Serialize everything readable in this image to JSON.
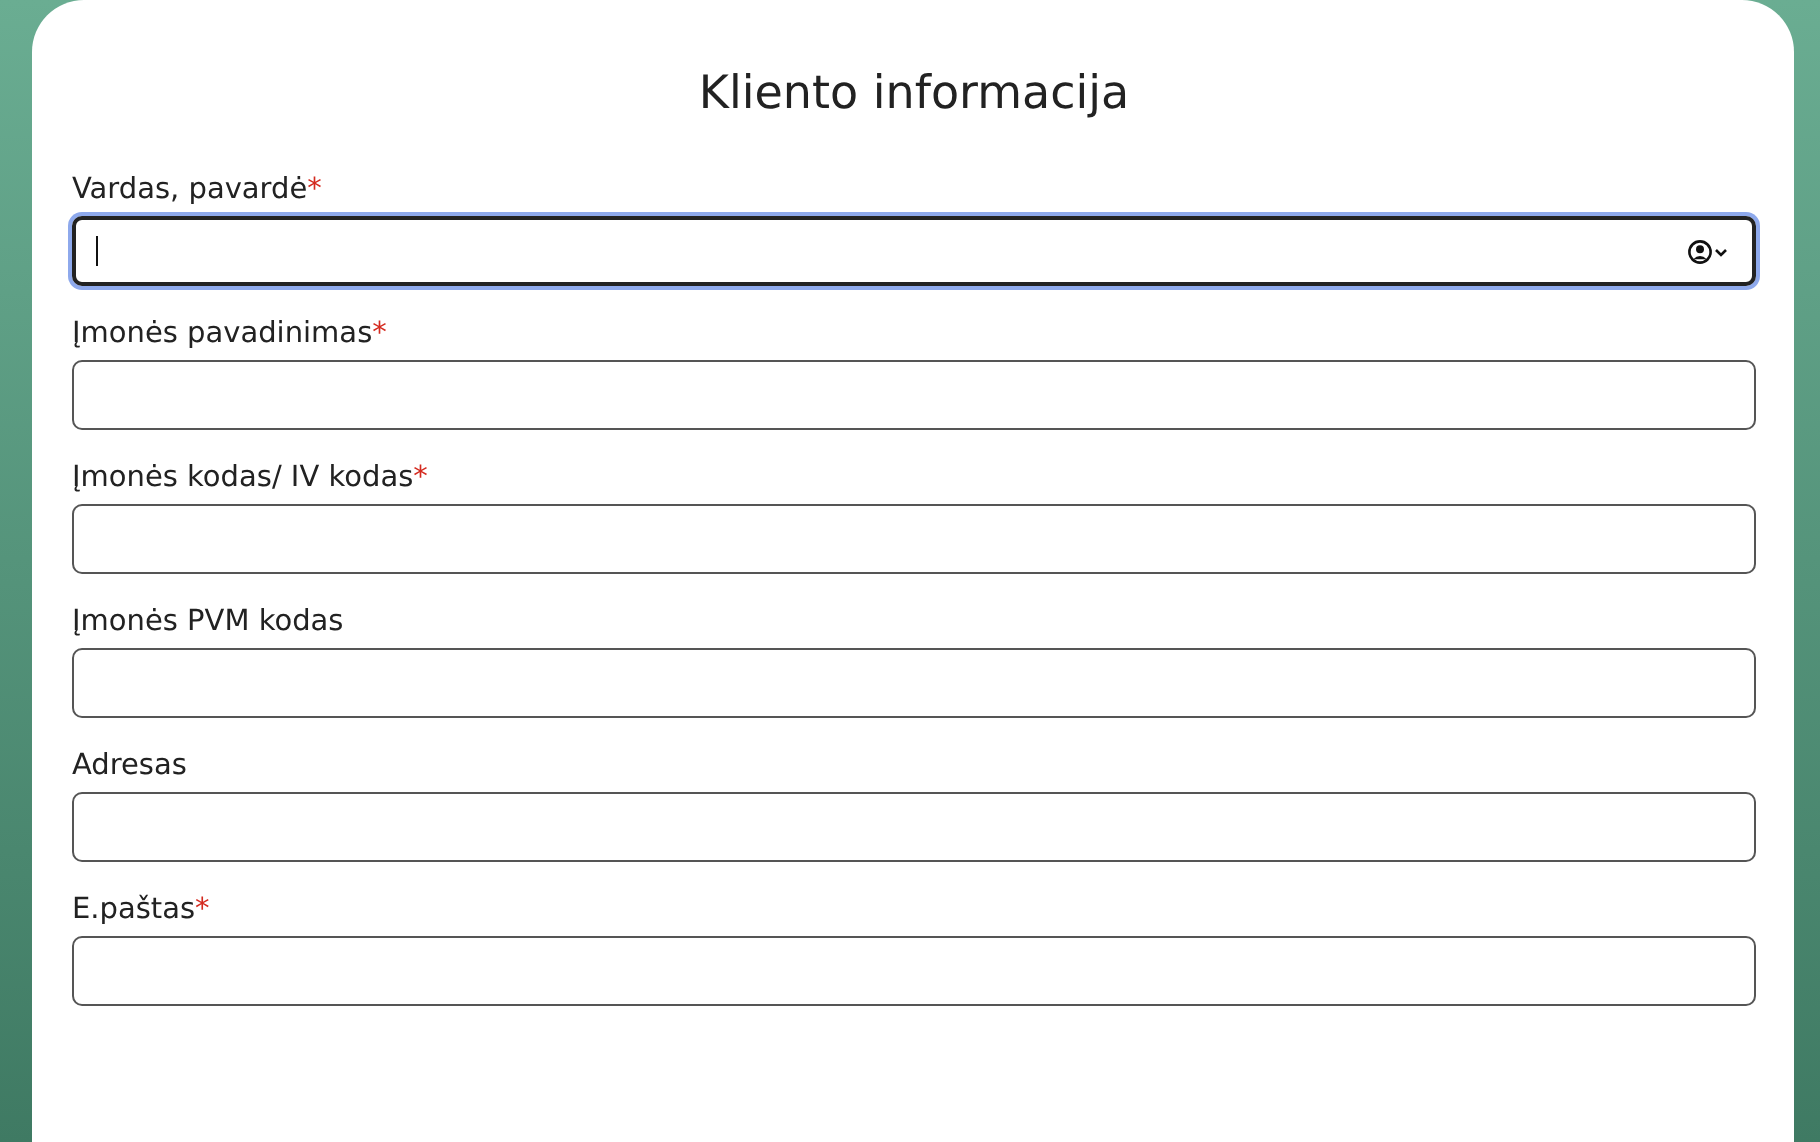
{
  "form": {
    "title": "Kliento informacija",
    "fields": [
      {
        "label": "Vardas, pavardė",
        "required": true,
        "focused": true,
        "autofill": true
      },
      {
        "label": "Įmonės pavadinimas",
        "required": true,
        "focused": false,
        "autofill": false
      },
      {
        "label": "Įmonės kodas/ IV kodas",
        "required": true,
        "focused": false,
        "autofill": false
      },
      {
        "label": "Įmonės PVM kodas",
        "required": false,
        "focused": false,
        "autofill": false
      },
      {
        "label": "Adresas",
        "required": false,
        "focused": false,
        "autofill": false
      },
      {
        "label": "E.paštas",
        "required": true,
        "focused": false,
        "autofill": false
      }
    ],
    "required_mark": "*"
  }
}
